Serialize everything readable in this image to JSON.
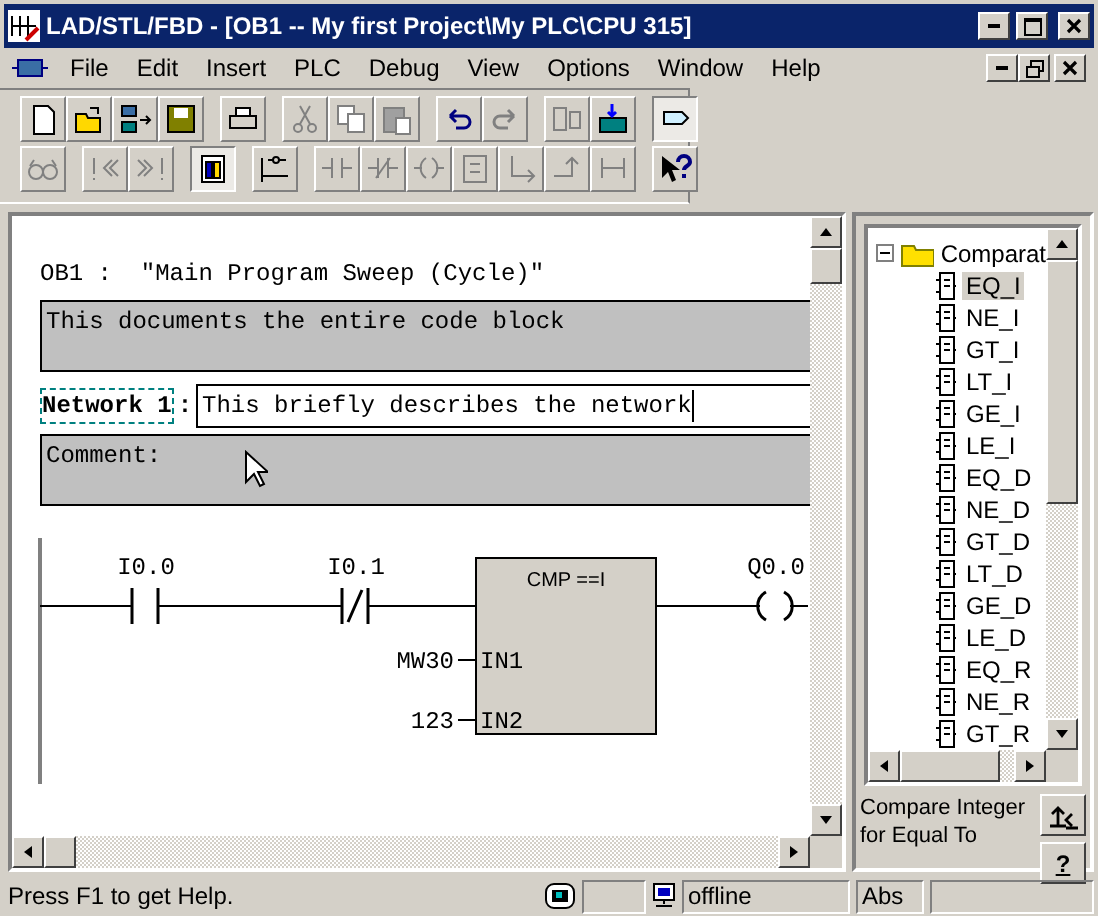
{
  "window": {
    "title": "LAD/STL/FBD  - [OB1 -- My first Project\\My PLC\\CPU 315]"
  },
  "menu": [
    "File",
    "Edit",
    "Insert",
    "PLC",
    "Debug",
    "View",
    "Options",
    "Window",
    "Help"
  ],
  "toolbar_rows": [
    [
      [
        {
          "kind": "new",
          "disabled": false
        },
        {
          "kind": "open",
          "disabled": false
        },
        {
          "kind": "nodes",
          "disabled": false
        },
        {
          "kind": "save",
          "disabled": false
        }
      ],
      [
        {
          "kind": "print",
          "disabled": false
        }
      ],
      [
        {
          "kind": "cut",
          "disabled": true
        },
        {
          "kind": "copy",
          "disabled": true
        },
        {
          "kind": "paste",
          "disabled": true
        }
      ],
      [
        {
          "kind": "undo",
          "disabled": false
        },
        {
          "kind": "redo",
          "disabled": true
        }
      ],
      [
        {
          "kind": "monitor",
          "disabled": true
        },
        {
          "kind": "download",
          "disabled": false
        }
      ],
      [
        {
          "kind": "details",
          "disabled": false,
          "pressed": true
        }
      ]
    ],
    [
      [
        {
          "kind": "glasses",
          "disabled": true
        }
      ],
      [
        {
          "kind": "first",
          "disabled": true
        },
        {
          "kind": "last",
          "disabled": true
        }
      ],
      [
        {
          "kind": "overview",
          "disabled": false,
          "pressed": true
        }
      ],
      [
        {
          "kind": "network",
          "disabled": false
        }
      ],
      [
        {
          "kind": "contact",
          "disabled": true
        },
        {
          "kind": "nc",
          "disabled": true
        },
        {
          "kind": "coil",
          "disabled": true
        },
        {
          "kind": "box",
          "disabled": true
        },
        {
          "kind": "branch",
          "disabled": true
        },
        {
          "kind": "close",
          "disabled": true
        },
        {
          "kind": "connect",
          "disabled": true
        }
      ],
      [
        {
          "kind": "help",
          "disabled": false
        }
      ]
    ]
  ],
  "editor": {
    "block_title": "OB1 :  \"Main Program Sweep (Cycle)\"",
    "block_comment": "This documents the entire code block",
    "network_label": "Network 1",
    "network_separator": ":",
    "network_title": "This briefly describes the network",
    "comment_label": "Comment:",
    "ladder": {
      "contacts": [
        {
          "kind": "no",
          "address": "I0.0"
        },
        {
          "kind": "nc",
          "address": "I0.1"
        }
      ],
      "box_title": "CMP ==I",
      "inputs": [
        {
          "pin": "IN1",
          "operand": "MW30"
        },
        {
          "pin": "IN2",
          "operand": "123"
        }
      ],
      "coil": "Q0.0"
    }
  },
  "catalog": {
    "folder": {
      "label": "Comparat",
      "expanded": true,
      "children": [
        {
          "label": "EQ_I",
          "selected": true
        },
        {
          "label": "NE_I",
          "selected": false
        },
        {
          "label": "GT_I",
          "selected": false
        },
        {
          "label": "LT_I",
          "selected": false
        },
        {
          "label": "GE_I",
          "selected": false
        },
        {
          "label": "LE_I",
          "selected": false
        },
        {
          "label": "EQ_D",
          "selected": false
        },
        {
          "label": "NE_D",
          "selected": false
        },
        {
          "label": "GT_D",
          "selected": false
        },
        {
          "label": "LT_D",
          "selected": false
        },
        {
          "label": "GE_D",
          "selected": false
        },
        {
          "label": "LE_D",
          "selected": false
        },
        {
          "label": "EQ_R",
          "selected": false
        },
        {
          "label": "NE_R",
          "selected": false
        },
        {
          "label": "GT_R",
          "selected": false
        }
      ]
    },
    "description": "Compare Integer for Equal To",
    "help_button": "?"
  },
  "status_bar": {
    "hint": "Press F1 to get Help.",
    "connection": "offline",
    "mode": "Abs"
  }
}
